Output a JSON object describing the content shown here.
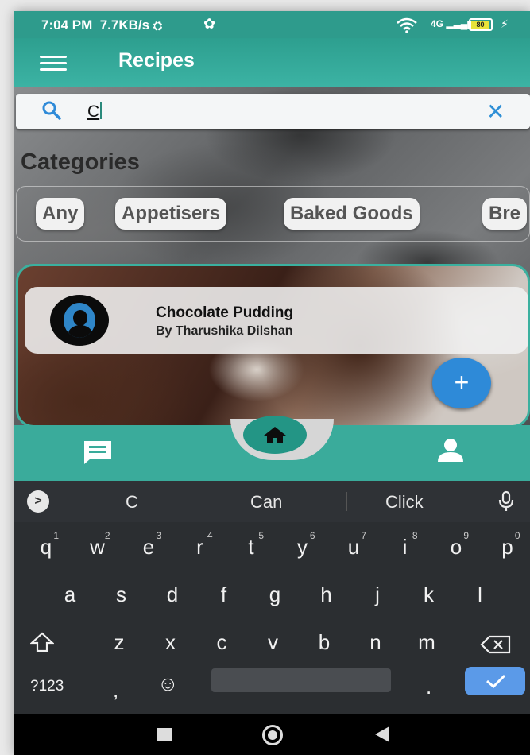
{
  "status_bar": {
    "time": "7:04 PM",
    "speed": "7.7KB/s",
    "signal": "4G",
    "battery": "80"
  },
  "app_bar": {
    "title": "Recipes"
  },
  "search": {
    "value": "C"
  },
  "categories": {
    "title": "Categories",
    "chips": [
      "Any",
      "Appetisers",
      "Baked Goods",
      "Bre"
    ]
  },
  "recipe": {
    "name": "Chocolate Pudding",
    "author": "By Tharushika Dilshan"
  },
  "fab": {
    "label": "+"
  },
  "keyboard": {
    "suggestions": [
      "C",
      "Can",
      "Click"
    ],
    "row1": [
      {
        "k": "q",
        "n": "1"
      },
      {
        "k": "w",
        "n": "2"
      },
      {
        "k": "e",
        "n": "3"
      },
      {
        "k": "r",
        "n": "4"
      },
      {
        "k": "t",
        "n": "5"
      },
      {
        "k": "y",
        "n": "6"
      },
      {
        "k": "u",
        "n": "7"
      },
      {
        "k": "i",
        "n": "8"
      },
      {
        "k": "o",
        "n": "9"
      },
      {
        "k": "p",
        "n": "0"
      }
    ],
    "row2": [
      "a",
      "s",
      "d",
      "f",
      "g",
      "h",
      "j",
      "k",
      "l"
    ],
    "row3": [
      "z",
      "x",
      "c",
      "v",
      "b",
      "n",
      "m"
    ],
    "symbols_key": "?123",
    "comma_key": ",",
    "period_key": "."
  },
  "colors": {
    "teal": "#3aab9b",
    "accent_blue": "#2e8ad8"
  }
}
